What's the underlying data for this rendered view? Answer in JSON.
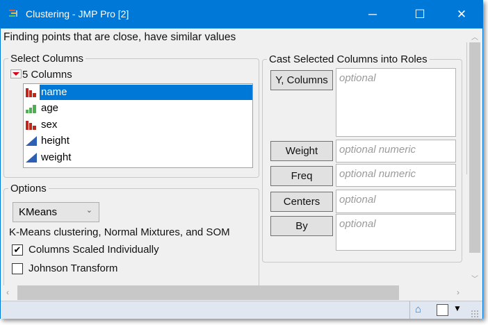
{
  "window": {
    "title": "Clustering - JMP Pro [2]",
    "minimize": "─",
    "maximize": "☐",
    "close": "✕"
  },
  "description": "Finding points that are close, have similar values",
  "select_columns": {
    "legend": "Select Columns",
    "count_label": "5 Columns",
    "columns": [
      {
        "name": "name",
        "type": "nominal"
      },
      {
        "name": "age",
        "type": "ordinal"
      },
      {
        "name": "sex",
        "type": "nominal"
      },
      {
        "name": "height",
        "type": "continuous"
      },
      {
        "name": "weight",
        "type": "continuous"
      }
    ]
  },
  "roles": {
    "legend": "Cast Selected Columns into Roles",
    "items": [
      {
        "label": "Y, Columns",
        "placeholder": "optional"
      },
      {
        "label": "Weight",
        "placeholder": "optional numeric"
      },
      {
        "label": "Freq",
        "placeholder": "optional numeric"
      },
      {
        "label": "Centers",
        "placeholder": "optional"
      },
      {
        "label": "By",
        "placeholder": "optional"
      }
    ]
  },
  "options": {
    "legend": "Options",
    "method": "KMeans",
    "method_desc": "K-Means clustering, Normal Mixtures, and SOM",
    "checkboxes": [
      {
        "label": "Columns Scaled Individually",
        "checked": true
      },
      {
        "label": "Johnson Transform",
        "checked": false
      }
    ]
  },
  "colors": {
    "accent": "#0078d7",
    "nominal": "#c0281c",
    "ordinal": "#4caf50",
    "continuous": "#2f5fb3"
  }
}
